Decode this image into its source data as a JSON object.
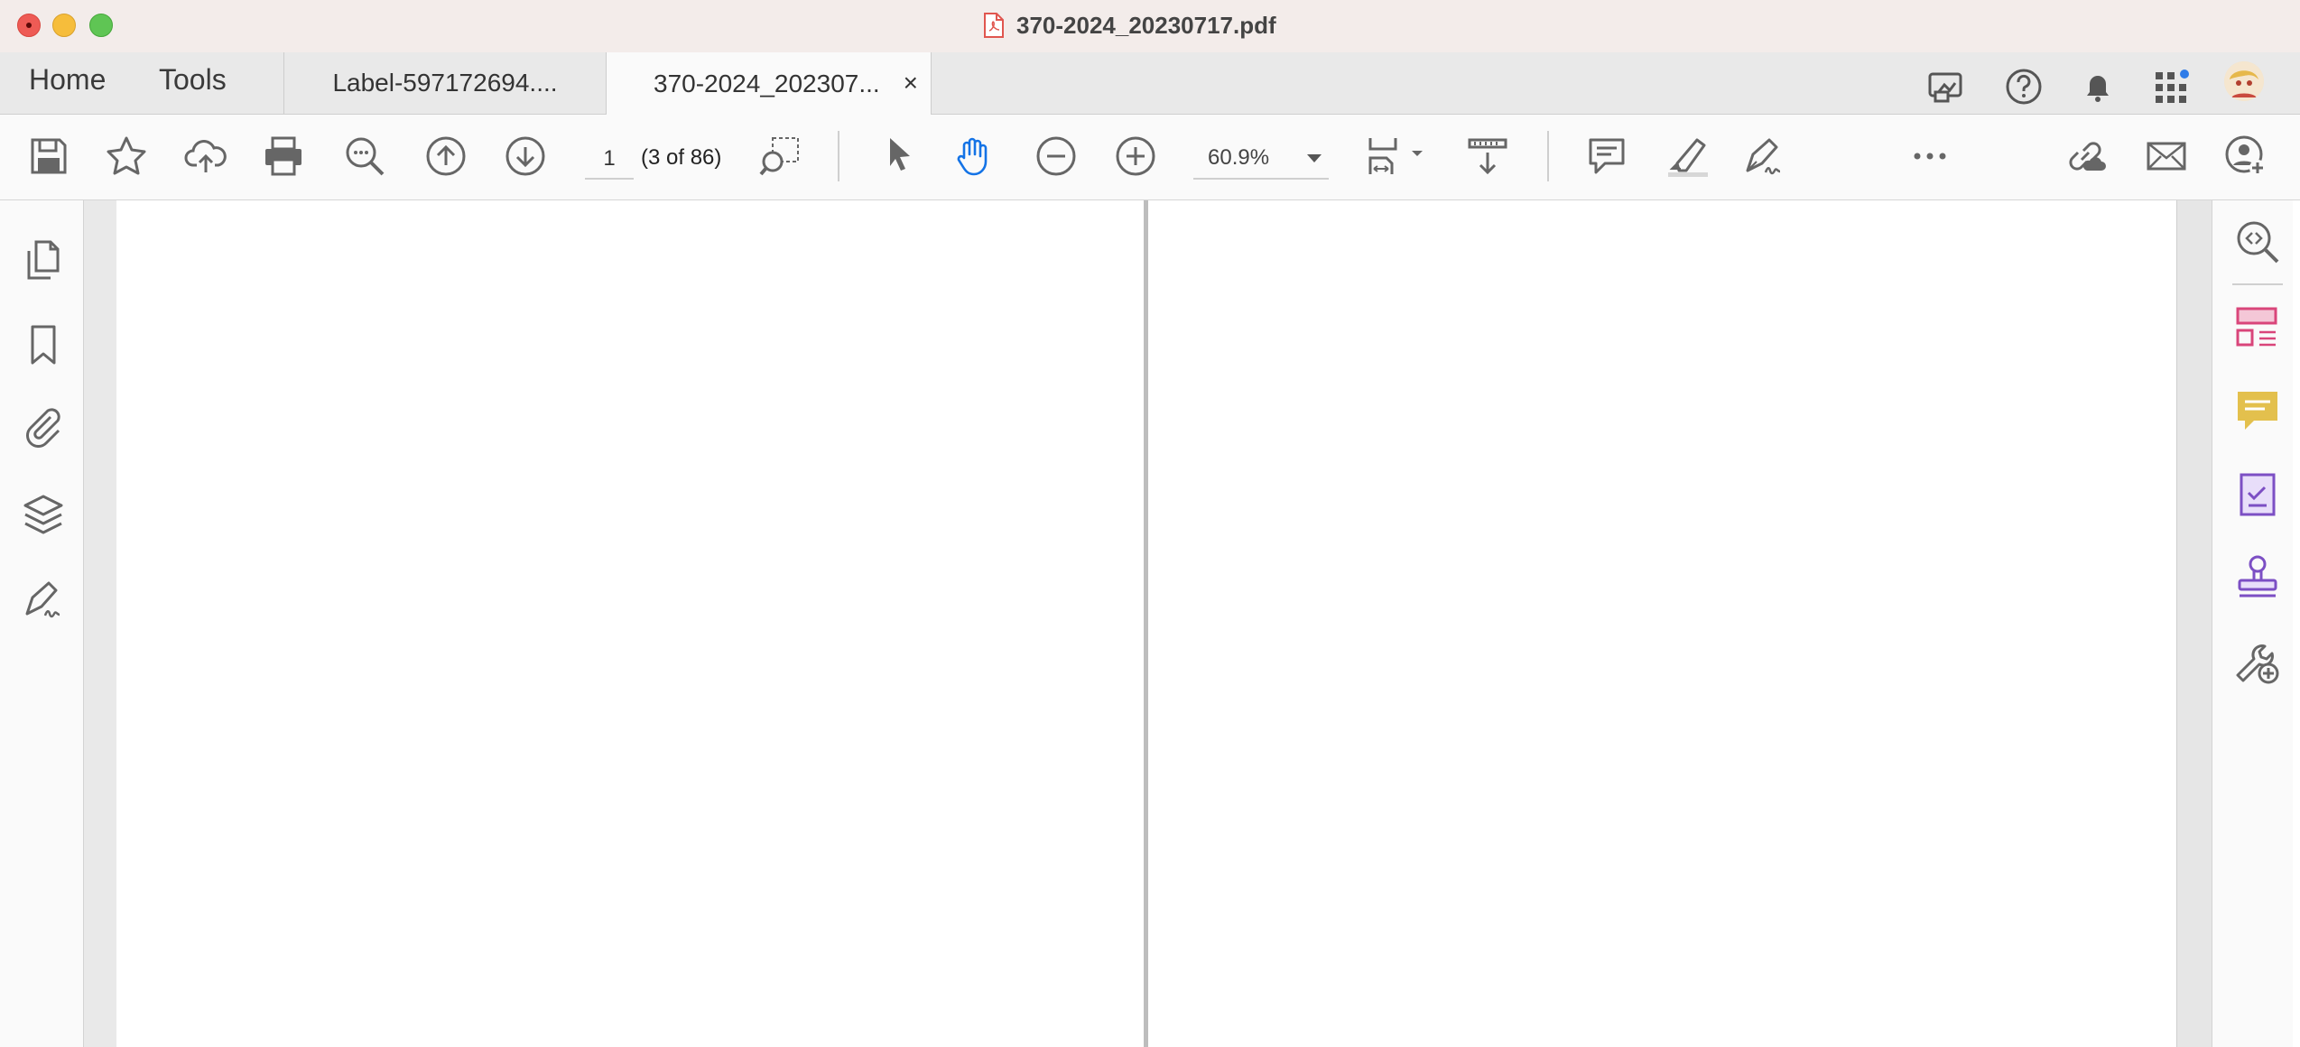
{
  "window": {
    "title": "370-2024_20230717.pdf",
    "title_icon": "pdf-file-icon"
  },
  "nav": {
    "home_label": "Home",
    "tools_label": "Tools"
  },
  "tabs": [
    {
      "label": "Label-597172694....",
      "active": false
    },
    {
      "label": "370-2024_202307...",
      "active": true,
      "close_label": "×"
    }
  ],
  "header_icons": [
    "share-screen-icon",
    "help-icon",
    "notification-bell-icon",
    "apps-grid-icon",
    "user-avatar"
  ],
  "toolbar": {
    "page_number": "1",
    "page_count": "(3 of 86)",
    "zoom": "60.9%",
    "icons": [
      "save-icon",
      "bookmark-star-icon",
      "upload-cloud-icon",
      "print-icon",
      "find-text-icon",
      "previous-page-icon",
      "next-page-icon",
      "marquee-zoom-icon",
      "select-cursor-icon",
      "hand-tool-icon",
      "zoom-out-icon",
      "zoom-in-icon",
      "page-fit-icon",
      "scroll-mode-icon",
      "add-comment-icon",
      "highlight-icon",
      "sign-icon",
      "more-icon",
      "share-link-icon",
      "email-icon",
      "add-user-icon"
    ],
    "hand_tool_active_color": "#1473e6"
  },
  "left_nav": [
    "page-thumbnails-icon",
    "bookmarks-icon",
    "attachments-icon",
    "layers-icon",
    "signatures-icon"
  ],
  "right_pane": {
    "icons": [
      "search-zoom-icon",
      "organize-pages-icon",
      "comment-icon",
      "fill-sign-icon",
      "stamp-icon",
      "more-tools-icon"
    ],
    "colors": {
      "organize": "#d9457a",
      "comment": "#d9b23b",
      "fill_sign": "#7c4fc4",
      "stamp": "#7c4fc4"
    }
  }
}
